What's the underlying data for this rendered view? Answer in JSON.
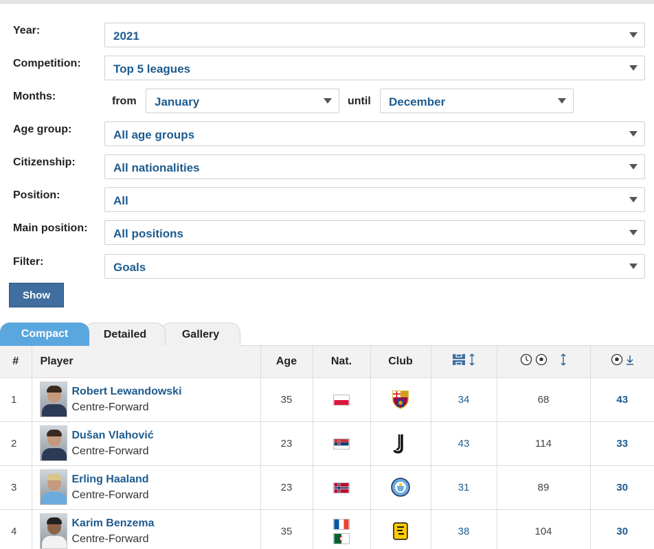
{
  "filters": {
    "year": {
      "label": "Year:",
      "value": "2021"
    },
    "competition": {
      "label": "Competition:",
      "value": "Top 5 leagues"
    },
    "months": {
      "label": "Months:",
      "from_label": "from",
      "from_value": "January",
      "until_label": "until",
      "until_value": "December"
    },
    "age_group": {
      "label": "Age group:",
      "value": "All age groups"
    },
    "citizenship": {
      "label": "Citizenship:",
      "value": "All nationalities"
    },
    "position": {
      "label": "Position:",
      "value": "All"
    },
    "main_position": {
      "label": "Main position:",
      "value": "All positions"
    },
    "filter": {
      "label": "Filter:",
      "value": "Goals"
    },
    "show_label": "Show"
  },
  "tabs": {
    "compact": "Compact",
    "detailed": "Detailed",
    "gallery": "Gallery",
    "active": "compact"
  },
  "table": {
    "headers": {
      "rank": "#",
      "player": "Player",
      "age": "Age",
      "nat": "Nat.",
      "club": "Club"
    },
    "icons": {
      "appearances": "pitch-icon",
      "minutes_per_goal": "clock-ball-icon",
      "goals": "ball-icon",
      "sort": "sort-arrows-icon",
      "sort_desc": "sort-down-icon"
    },
    "rows": [
      {
        "rank": "1",
        "name": "Robert Lewandowski",
        "position": "Centre-Forward",
        "age": "35",
        "nat": [
          "poland-flag"
        ],
        "club": "barcelona-crest",
        "appearances": "34",
        "minutes_per_goal": "68",
        "goals": "43"
      },
      {
        "rank": "2",
        "name": "Dušan Vlahović",
        "position": "Centre-Forward",
        "age": "23",
        "nat": [
          "serbia-flag"
        ],
        "club": "juventus-crest",
        "appearances": "43",
        "minutes_per_goal": "114",
        "goals": "33"
      },
      {
        "rank": "3",
        "name": "Erling Haaland",
        "position": "Centre-Forward",
        "age": "23",
        "nat": [
          "norway-flag"
        ],
        "club": "manchester-city-crest",
        "appearances": "31",
        "minutes_per_goal": "89",
        "goals": "30"
      },
      {
        "rank": "4",
        "name": "Karim Benzema",
        "position": "Centre-Forward",
        "age": "35",
        "nat": [
          "france-flag",
          "algeria-flag"
        ],
        "club": "al-ittihad-crest",
        "appearances": "38",
        "minutes_per_goal": "104",
        "goals": "30"
      }
    ]
  },
  "colors": {
    "link": "#1d5b8f",
    "active_tab": "#5aa6df",
    "button": "#3f6e9f"
  }
}
